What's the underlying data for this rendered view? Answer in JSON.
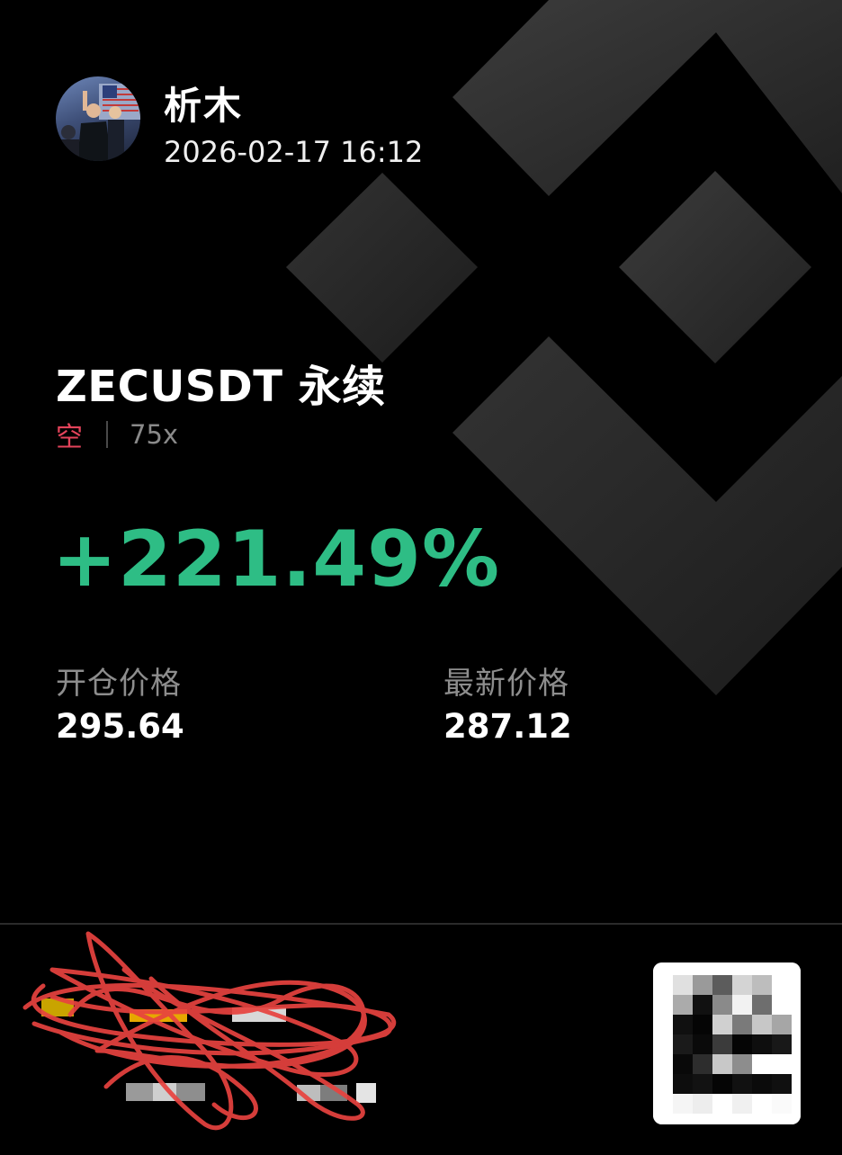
{
  "header": {
    "username": "析木",
    "timestamp": "2026-02-17 16:12",
    "avatar_icon": "user-avatar-photo"
  },
  "position": {
    "symbol": "ZECUSDT 永续",
    "side": "空",
    "leverage": "75x",
    "pnl_percent": "+221.49%"
  },
  "prices": {
    "entry_label": "开仓价格",
    "entry_value": "295.64",
    "mark_label": "最新价格",
    "mark_value": "287.12"
  },
  "footer": {
    "referral_icon": "redacted-scribble",
    "qr_icon": "qr-code-icon"
  },
  "colors": {
    "background": "#000000",
    "profit": "#2ebd85",
    "short": "#e3435a",
    "muted": "#8d8d8d",
    "scribble": "#e8433f"
  }
}
